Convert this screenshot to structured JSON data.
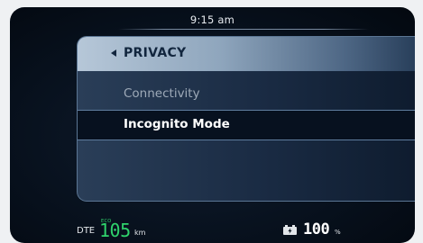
{
  "status_bar": {
    "time": "9:15 am"
  },
  "menu": {
    "title": "PRIVACY",
    "items": [
      {
        "label": "Connectivity",
        "selected": false
      },
      {
        "label": "Incognito Mode",
        "selected": true
      }
    ]
  },
  "footer": {
    "dte_label": "DTE",
    "mode_label": "ECO",
    "range_value": "105",
    "range_unit": "km",
    "battery_value": "100",
    "battery_unit": "%"
  },
  "colors": {
    "eco_green": "#2fd36c",
    "header_start": "#b6c7d8",
    "selected_bg": "#07111f",
    "panel_border": "#5b7694"
  },
  "icons": {
    "back": "chevron-left-icon",
    "battery": "battery-charging-icon"
  }
}
